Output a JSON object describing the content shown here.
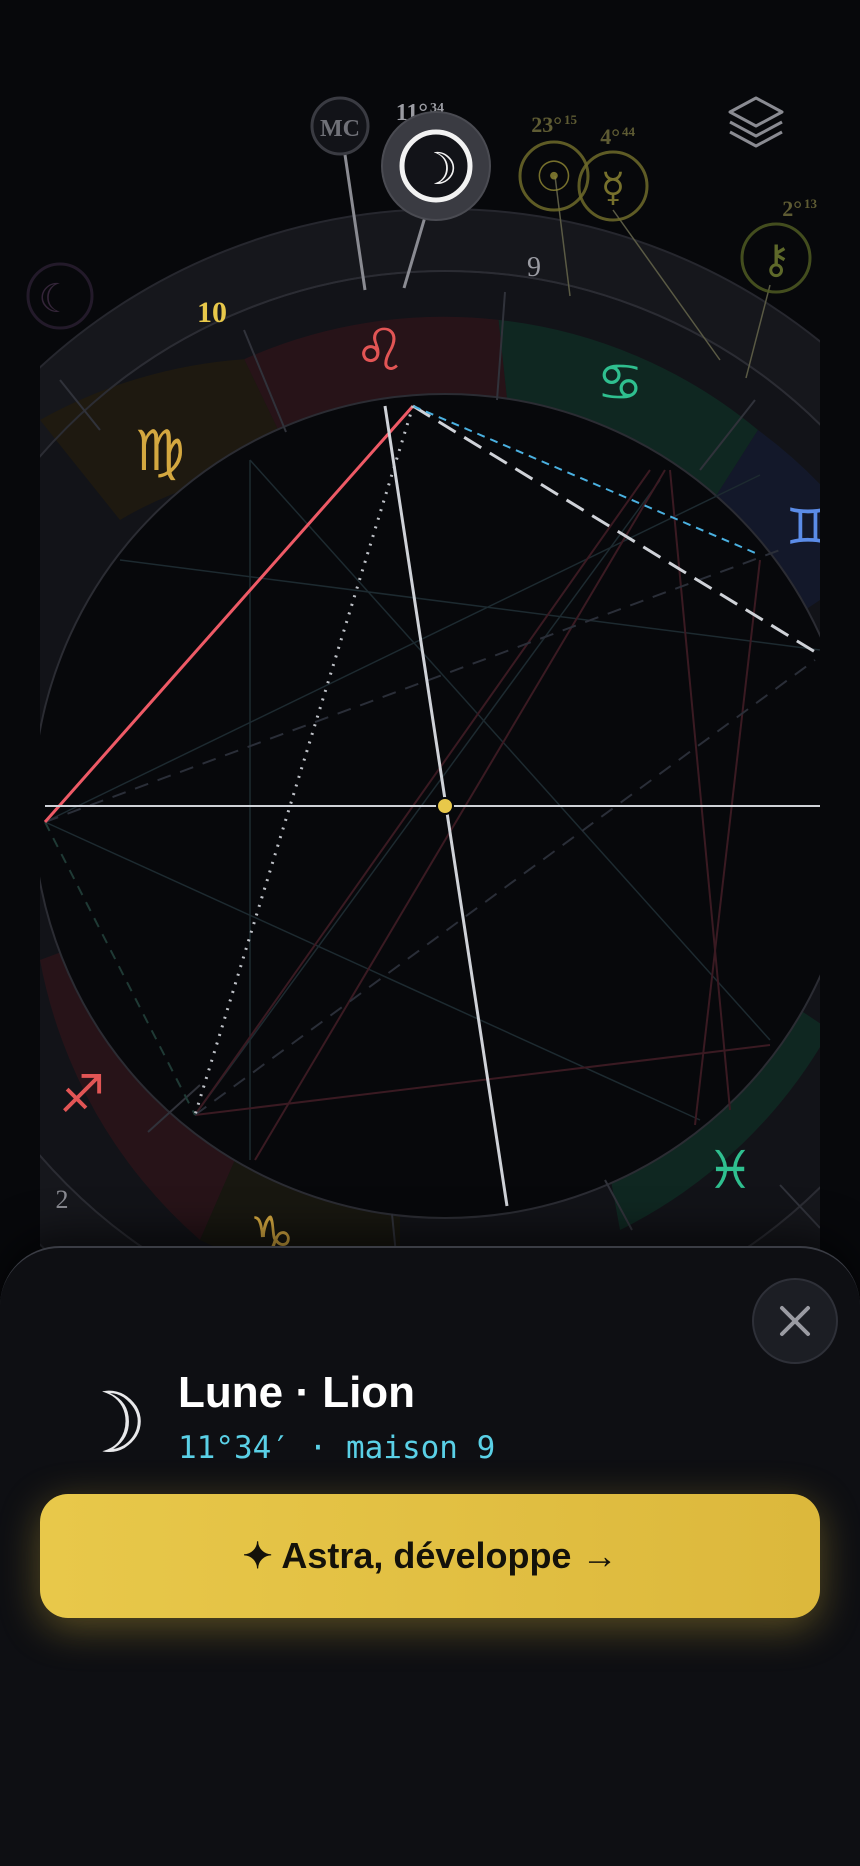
{
  "chart": {
    "house_labels": {
      "h10": "10",
      "h9": "9",
      "h2": "2"
    },
    "planets": {
      "mc": {
        "glyph": "MC"
      },
      "moon": {
        "glyph": "☽",
        "degree": "11°",
        "minutes": "34"
      },
      "sun": {
        "glyph": "☉",
        "degree": "23°",
        "minutes": "15"
      },
      "mercury": {
        "glyph": "☿",
        "degree": "4°",
        "minutes": "44"
      },
      "chiron": {
        "glyph": "⚷",
        "degree": "2°",
        "minutes": "13"
      },
      "left_partial": {
        "glyph": "☾"
      }
    },
    "signs": {
      "leo": "♌",
      "cancer": "♋",
      "virgo": "♍",
      "gemini": "♊",
      "sagittarius": "♐",
      "capricorn": "♑",
      "pisces": "♓"
    },
    "colors": {
      "fire": "#e25555",
      "water": "#2fbf8f",
      "earth": "#d4a840",
      "air": "#5b8ce8",
      "accent": "#e8c84a",
      "aspect_line": "#ee5a66"
    }
  },
  "detail": {
    "glyph": "☽",
    "title": "Lune · Lion",
    "subtitle": "11°34′ · maison 9",
    "cta_label": "✦ Astra, développe →"
  }
}
